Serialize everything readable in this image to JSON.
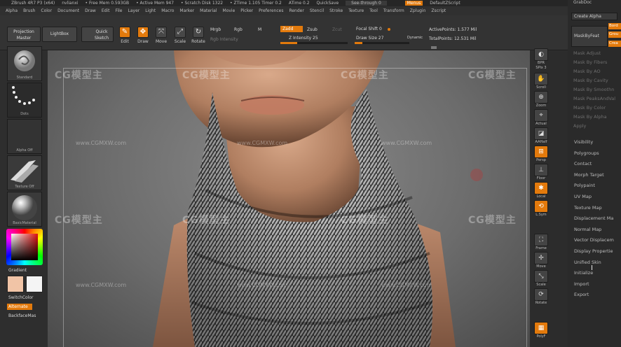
{
  "titlebar": {
    "app": "ZBrush 4R7 P3 (x64)",
    "user": "nvlianxi",
    "free_mem": "• Free Mem 0.593GB",
    "active_mem": "• Active Mem 947",
    "scratch": "• Scratch Disk 1322",
    "ztime": "• ZTime 1.105 Timer 0.2",
    "atime": "ATime 0.2",
    "quicksave": "QuickSave",
    "see_through": "See-through  0",
    "menus": "Menus",
    "script": "DefaultZScript"
  },
  "menubar": {
    "items": [
      "Alpha",
      "Brush",
      "Color",
      "Document",
      "Draw",
      "Edit",
      "File",
      "Layer",
      "Light",
      "Macro",
      "Marker",
      "Material",
      "Movie",
      "Picker",
      "Preferences",
      "Render",
      "Stencil",
      "Stroke",
      "Texture",
      "Tool",
      "Transform",
      "Zplugin",
      "Zscript"
    ]
  },
  "shelf": {
    "projection_master": "Projection Master",
    "lightbox": "LightBox",
    "quick_sketch": "Quick Sketch",
    "edit": "Edit",
    "draw": "Draw",
    "move": "Move",
    "scale": "Scale",
    "rotate": "Rotate",
    "mrgb": "Mrgb",
    "rgb": "Rgb",
    "m": "M",
    "rgb_intensity": "Rgb Intensity",
    "zadd": "Zadd",
    "zsub": "Zsub",
    "zcut": "Zcut",
    "z_intensity": "Z Intensity 25",
    "focal_shift": "Focal Shift 0",
    "draw_size": "Draw Size 27",
    "dynamic": "Dynamic",
    "active_points": "ActivePoints: 1.577 Mil",
    "total_points": "TotalPoints: 12.531 Mil",
    "z_intensity_value": 25,
    "draw_size_value": 27
  },
  "left": {
    "brush": "Standard",
    "stroke": "Dots",
    "alpha": "Alpha Off",
    "texture": "Texture Off",
    "material": "BasicMaterial",
    "gradient": "Gradient",
    "switch_color": "SwitchColor",
    "alternate": "Alternate",
    "backface": "BackfaceMas"
  },
  "viewport": {
    "watermark_main": "CG模型主",
    "watermark_url": "www.CGMXW.com"
  },
  "rstrip": {
    "bpr": "BPR",
    "spix": "SPix 3",
    "scroll": "Scroll",
    "zoom": "Zoom",
    "actual": "Actual",
    "aahalf": "AAHalf",
    "persp": "Persp",
    "floor": "Floor",
    "local": "Local",
    "xyz": "L.Sym",
    "frame": "Frame",
    "move": "Move",
    "scale": "Scale",
    "rotate": "Rotate",
    "polyf": "PolyF"
  },
  "rpanel": {
    "grab_doc": "GrabDoc",
    "create_alpha": "Create Alpha",
    "mask_by_feature": "MaskByFeat",
    "border": "Bord",
    "groups": "Grou",
    "crease": "Crea",
    "mask_items": [
      "Mask Adjust",
      "Mask By Fibers",
      "Mask By AO",
      "Mask By Cavity",
      "Mask By Smoothn",
      "Mask PeaksAndVal",
      "Mask By Color",
      "Mask By Alpha",
      "Apply"
    ],
    "subpalettes": [
      "Visibility",
      "Polygroups",
      "Contact",
      "Morph Target",
      "Polypaint",
      "UV Map",
      "Texture Map",
      "Displacement Ma",
      "Normal Map",
      "Vector Displacem",
      "Display Propertie",
      "Unified Skin",
      "Initialize",
      "Import",
      "Export"
    ]
  }
}
